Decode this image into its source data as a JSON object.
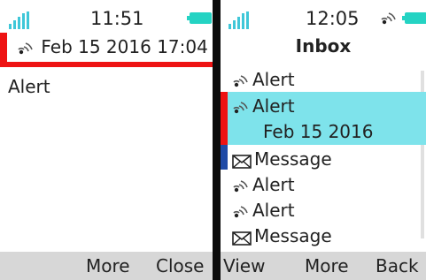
{
  "left": {
    "status": {
      "time": "11:51"
    },
    "header": {
      "icon": "alert-icon",
      "datetime": "Feb 15 2016 17:04",
      "marker_color": "#ee1313"
    },
    "body_text": "Alert",
    "softkeys": {
      "more": "More",
      "close": "Close"
    }
  },
  "right": {
    "status": {
      "time": "12:05"
    },
    "title": "Inbox",
    "items": [
      {
        "icon": "alert-icon",
        "label": "Alert"
      },
      {
        "icon": "alert-icon",
        "label": "Alert",
        "date": "Feb 15 2016",
        "selected": true,
        "marker_color": "#ee1313"
      },
      {
        "icon": "mail-icon",
        "label": "Message",
        "marker_color": "#1f4aa6"
      },
      {
        "icon": "alert-icon",
        "label": "Alert"
      },
      {
        "icon": "alert-icon",
        "label": "Alert"
      },
      {
        "icon": "mail-icon",
        "label": "Message"
      }
    ],
    "softkeys": {
      "view": "View",
      "more": "More",
      "back": "Back"
    }
  },
  "colors": {
    "accent": "#3fc7d8",
    "battery": "#24d3c3",
    "selection": "#7ee3eb",
    "alert_marker": "#ee1313",
    "message_marker": "#1f4aa6",
    "softkey_bar": "#d7d7d7"
  }
}
